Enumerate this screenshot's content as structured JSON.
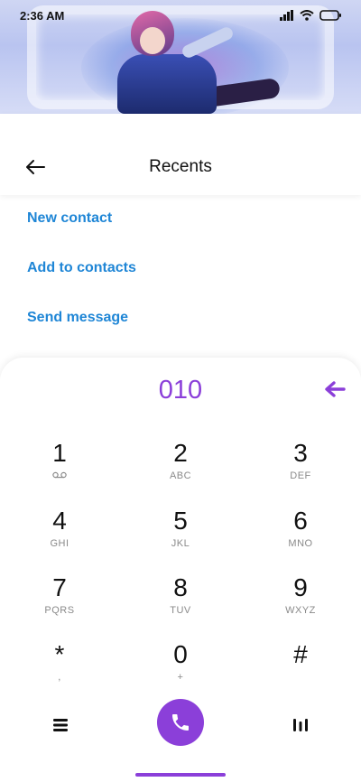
{
  "status": {
    "time": "2:36 AM",
    "icons": [
      "signal-icon",
      "wifi-icon",
      "battery-icon"
    ]
  },
  "header": {
    "title": "Recents",
    "back_icon": "back-arrow-icon"
  },
  "actions": [
    {
      "label": "New contact"
    },
    {
      "label": "Add to contacts"
    },
    {
      "label": "Send message"
    }
  ],
  "dialer": {
    "number": "010",
    "backspace_icon": "backspace-icon",
    "keys": [
      {
        "digit": "1",
        "letters": "",
        "icon": "voicemail-icon"
      },
      {
        "digit": "2",
        "letters": "ABC"
      },
      {
        "digit": "3",
        "letters": "DEF"
      },
      {
        "digit": "4",
        "letters": "GHI"
      },
      {
        "digit": "5",
        "letters": "JKL"
      },
      {
        "digit": "6",
        "letters": "MNO"
      },
      {
        "digit": "7",
        "letters": "PQRS"
      },
      {
        "digit": "8",
        "letters": "TUV"
      },
      {
        "digit": "9",
        "letters": "WXYZ"
      },
      {
        "digit": "*",
        "letters": ","
      },
      {
        "digit": "0",
        "letters": "+"
      },
      {
        "digit": "#",
        "letters": ""
      }
    ],
    "menu_icon": "menu-icon",
    "call_icon": "phone-icon",
    "pause_icon": "pause-icon"
  },
  "colors": {
    "accent": "#8b3fd9",
    "link": "#1f86d6"
  }
}
